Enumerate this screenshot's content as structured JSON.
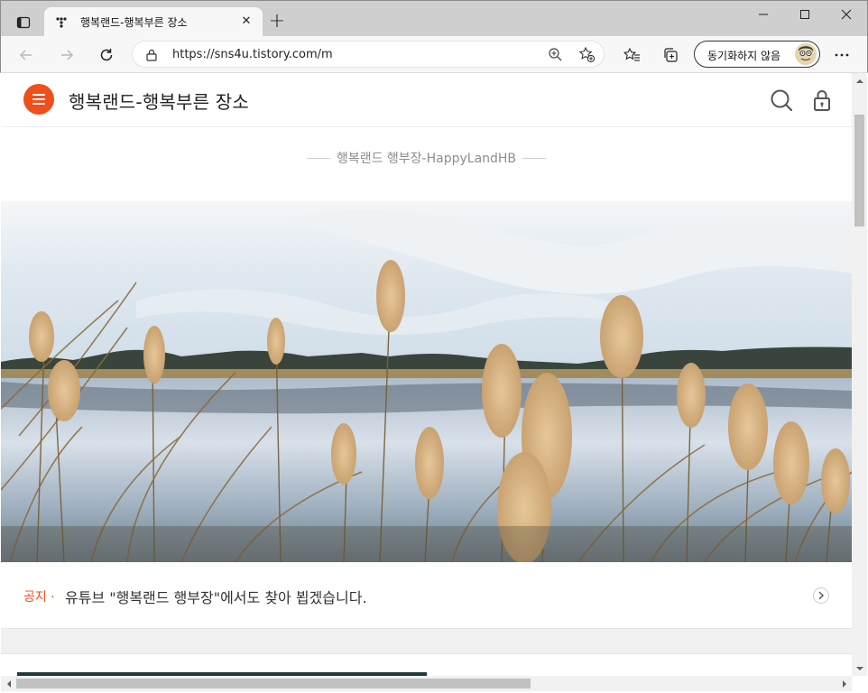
{
  "browser": {
    "tab_title": "행복랜드-행복부른 장소",
    "tab_close": "✕",
    "new_tab": "+",
    "url": "https://sns4u.tistory.com/m",
    "sync_label": "동기화하지 않음"
  },
  "site": {
    "title": "행복랜드-행복부른 장소",
    "tagline": "행복랜드 행부장-HappyLandHB"
  },
  "notice": {
    "label": "공지 ·",
    "text": "유튜브 \"행복랜드 행부장\"에서도 찾아 뵙겠습니다."
  },
  "colors": {
    "accent": "#ee4f1b",
    "tagline": "#8d8d8d",
    "dark_strip": "#1e3a3a"
  },
  "icons": {
    "menu": "hamburger-icon",
    "search": "search-icon",
    "lock": "lock-icon",
    "notice_arrow": "chevron-right-icon"
  }
}
